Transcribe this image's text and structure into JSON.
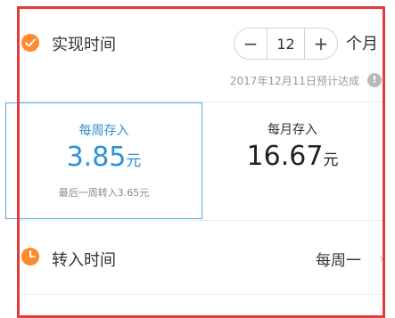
{
  "time_row": {
    "label": "实现时间",
    "stepper": {
      "minus": "−",
      "value": "12",
      "plus": "+"
    },
    "unit": "个月",
    "estimate": "2017年12月11日预计达成",
    "info_icon_text": "!",
    "icons": {
      "check": "check-circle-icon",
      "info": "info-icon"
    },
    "accent_color": "#ff8a2b"
  },
  "savings_options": [
    {
      "title": "每周存入",
      "amount": "3.85",
      "currency": "元",
      "note": "最后一周转入3.65元",
      "selected": true,
      "color": "#2d8fd6"
    },
    {
      "title": "每月存入",
      "amount": "16.67",
      "currency": "元",
      "selected": false,
      "color": "#222222"
    }
  ],
  "transfer_row": {
    "label": "转入时间",
    "value": "每周一",
    "chevron": "›",
    "icons": {
      "clock": "clock-icon",
      "chevron": "chevron-right-icon"
    }
  },
  "highlight": {
    "frame_color": "#e33a3a"
  }
}
